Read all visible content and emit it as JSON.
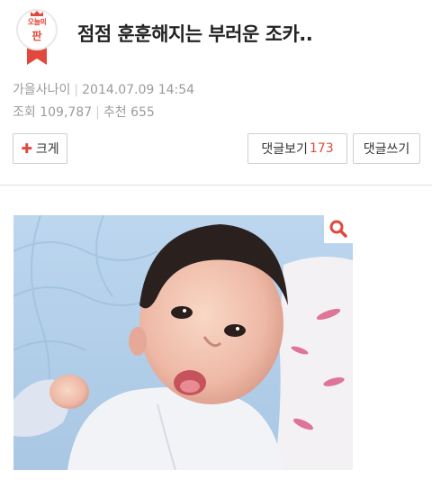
{
  "header": {
    "badge_top": "오늘의",
    "badge_main": "판",
    "title": "점점 훈훈해지는 부러운 조카.."
  },
  "meta": {
    "author": "가을사나이",
    "datetime": "2014.07.09 14:54",
    "views_label": "조회",
    "views": "109,787",
    "likes_label": "추천",
    "likes": "655"
  },
  "actions": {
    "bigger_label": "크게",
    "comments_label": "댓글보기",
    "comments_count": "173",
    "write_label": "댓글쓰기"
  },
  "colors": {
    "accent": "#e2483d"
  },
  "icons": {
    "zoom": "search-icon",
    "plus": "plus-icon"
  }
}
